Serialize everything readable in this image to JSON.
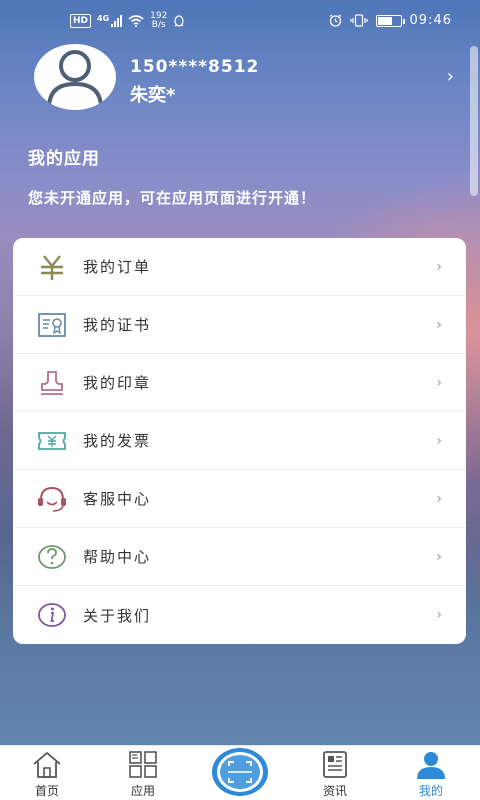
{
  "status_bar": {
    "hd": "HD",
    "network": "4G",
    "speed_value": "192",
    "speed_unit": "B/s",
    "time": "09:46"
  },
  "profile": {
    "phone": "150****8512",
    "name": "朱奕*"
  },
  "my_apps": {
    "title": "我的应用",
    "notice": "您未开通应用，可在应用页面进行开通！"
  },
  "menu": [
    {
      "label": "我的订单",
      "icon": "yen-icon"
    },
    {
      "label": "我的证书",
      "icon": "certificate-icon"
    },
    {
      "label": "我的印章",
      "icon": "stamp-icon"
    },
    {
      "label": "我的发票",
      "icon": "invoice-icon"
    },
    {
      "label": "客服中心",
      "icon": "headset-icon"
    },
    {
      "label": "帮助中心",
      "icon": "question-icon"
    },
    {
      "label": "关于我们",
      "icon": "info-icon"
    }
  ],
  "bottom_nav": [
    {
      "label": "首页",
      "icon": "home-icon"
    },
    {
      "label": "应用",
      "icon": "apps-grid-icon"
    },
    {
      "label": "",
      "icon": "scan-icon"
    },
    {
      "label": "资讯",
      "icon": "news-icon"
    },
    {
      "label": "我的",
      "icon": "user-icon"
    }
  ],
  "colors": {
    "accent": "#2c8ad8",
    "order_icon": "#8e8a53",
    "certificate_icon": "#6a8aa8",
    "stamp_icon": "#b4708e",
    "invoice_icon": "#4fa6a2",
    "headset_icon": "#a85460",
    "question_icon": "#6e9a6e",
    "info_icon": "#7a5a9a"
  }
}
